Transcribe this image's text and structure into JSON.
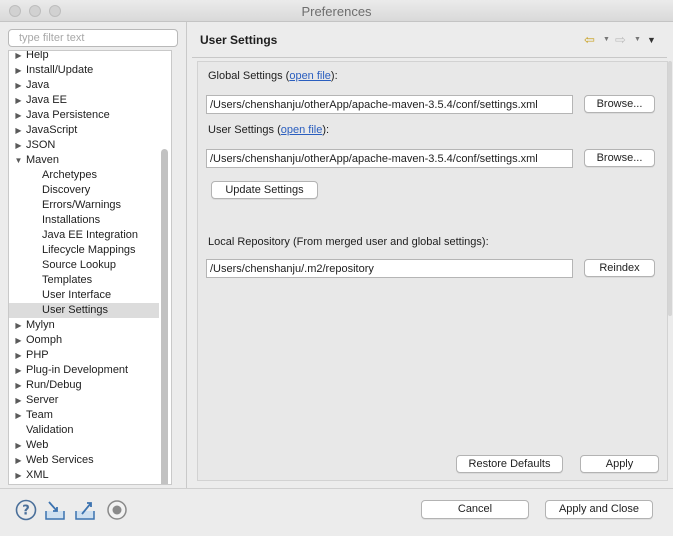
{
  "window": {
    "title": "Preferences"
  },
  "sidebar": {
    "filter_placeholder": "type filter text",
    "items": [
      {
        "label": "Help",
        "level": 0,
        "twisty": "collapsed"
      },
      {
        "label": "Install/Update",
        "level": 0,
        "twisty": "collapsed"
      },
      {
        "label": "Java",
        "level": 0,
        "twisty": "collapsed"
      },
      {
        "label": "Java EE",
        "level": 0,
        "twisty": "collapsed"
      },
      {
        "label": "Java Persistence",
        "level": 0,
        "twisty": "collapsed"
      },
      {
        "label": "JavaScript",
        "level": 0,
        "twisty": "collapsed"
      },
      {
        "label": "JSON",
        "level": 0,
        "twisty": "collapsed"
      },
      {
        "label": "Maven",
        "level": 0,
        "twisty": "expanded"
      },
      {
        "label": "Archetypes",
        "level": 1,
        "twisty": "none"
      },
      {
        "label": "Discovery",
        "level": 1,
        "twisty": "none"
      },
      {
        "label": "Errors/Warnings",
        "level": 1,
        "twisty": "none"
      },
      {
        "label": "Installations",
        "level": 1,
        "twisty": "none"
      },
      {
        "label": "Java EE Integration",
        "level": 1,
        "twisty": "none"
      },
      {
        "label": "Lifecycle Mappings",
        "level": 1,
        "twisty": "none"
      },
      {
        "label": "Source Lookup",
        "level": 1,
        "twisty": "none"
      },
      {
        "label": "Templates",
        "level": 1,
        "twisty": "none"
      },
      {
        "label": "User Interface",
        "level": 1,
        "twisty": "none"
      },
      {
        "label": "User Settings",
        "level": 1,
        "twisty": "none",
        "selected": true
      },
      {
        "label": "Mylyn",
        "level": 0,
        "twisty": "collapsed"
      },
      {
        "label": "Oomph",
        "level": 0,
        "twisty": "collapsed"
      },
      {
        "label": "PHP",
        "level": 0,
        "twisty": "collapsed"
      },
      {
        "label": "Plug-in Development",
        "level": 0,
        "twisty": "collapsed"
      },
      {
        "label": "Run/Debug",
        "level": 0,
        "twisty": "collapsed"
      },
      {
        "label": "Server",
        "level": 0,
        "twisty": "collapsed"
      },
      {
        "label": "Team",
        "level": 0,
        "twisty": "collapsed"
      },
      {
        "label": "Validation",
        "level": 0,
        "twisty": "none"
      },
      {
        "label": "Web",
        "level": 0,
        "twisty": "collapsed"
      },
      {
        "label": "Web Services",
        "level": 0,
        "twisty": "collapsed"
      },
      {
        "label": "XML",
        "level": 0,
        "twisty": "collapsed"
      }
    ]
  },
  "page": {
    "title": "User Settings",
    "global_settings": {
      "label_prefix": "Global Settings (",
      "link": "open file",
      "label_suffix": "):",
      "value": "/Users/chenshanju/otherApp/apache-maven-3.5.4/conf/settings.xml",
      "browse_label": "Browse..."
    },
    "user_settings": {
      "label_prefix": "User Settings (",
      "link": "open file",
      "label_suffix": "):",
      "value": "/Users/chenshanju/otherApp/apache-maven-3.5.4/conf/settings.xml",
      "browse_label": "Browse..."
    },
    "update_settings_label": "Update Settings",
    "local_repository": {
      "label": "Local Repository (From merged user and global settings):",
      "value": "/Users/chenshanju/.m2/repository",
      "reindex_label": "Reindex"
    },
    "restore_defaults_label": "Restore Defaults",
    "apply_label": "Apply"
  },
  "footer": {
    "cancel_label": "Cancel",
    "apply_close_label": "Apply and Close"
  },
  "colors": {
    "link": "#2a5ebf",
    "selection": "#dcdcdc",
    "back_arrow": "#c8a020"
  },
  "icons": {
    "help": "help-icon",
    "import": "import-icon",
    "export": "export-icon",
    "record": "record-icon",
    "back": "back-arrow-icon",
    "forward": "forward-arrow-icon",
    "view_menu": "view-menu-icon"
  }
}
